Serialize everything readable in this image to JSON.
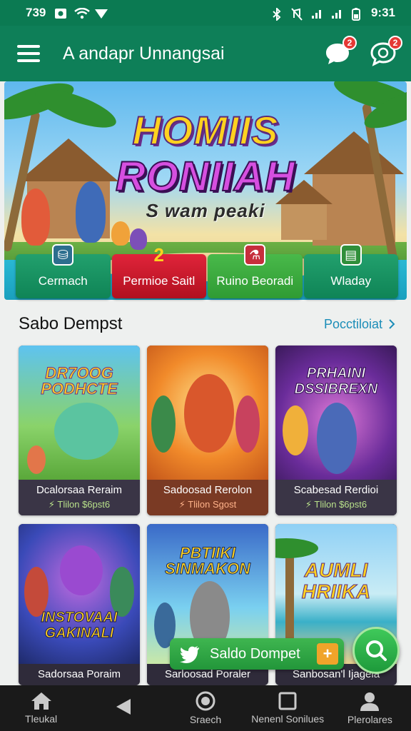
{
  "status_bar": {
    "time_left": "739",
    "time_right": "9:31"
  },
  "app_bar": {
    "title": "A andapr Unnangsai",
    "chat_badge": "2",
    "notify_badge": "2"
  },
  "hero": {
    "title_line1": "HOMIIS",
    "title_line2": "RONIIAH",
    "title_line3": "S wam peaki"
  },
  "tabs": [
    {
      "label": "Cermach",
      "icon": "barrel-icon"
    },
    {
      "label": "Permioe Saitl",
      "icon": "swirl-icon"
    },
    {
      "label": "Ruino Beoradi",
      "icon": "potion-icon"
    },
    {
      "label": "Wladay",
      "icon": "ledger-icon"
    }
  ],
  "section": {
    "title": "Sabo Dempst",
    "link": "Pocctiloiat"
  },
  "games": [
    {
      "art_title": "DR7OOG PODHCTE",
      "name": "Dcalorsaa Reraim",
      "meta": "Tlilon $6pst6"
    },
    {
      "art_title": "",
      "name": "Sadoosad Rerolon",
      "meta": "Tlilon Sgost"
    },
    {
      "art_title": "PRHAINI DSSIBREXN",
      "name": "Scabesad Rerdioi",
      "meta": "Tlilon $6pst6"
    },
    {
      "art_title": "INSTOVAAI GAKINALI",
      "name": "Sadorsaa Poraim",
      "meta": ""
    },
    {
      "art_title": "PBTIIKI SINMAKON",
      "name": "Sarloosad Poraler",
      "meta": ""
    },
    {
      "art_title": "AUMLI HRIIKA",
      "name": "Sanbosan'l Ijagela",
      "meta": ""
    }
  ],
  "wallet": {
    "label": "Saldo Dompet",
    "plus": "+"
  },
  "bottom_nav": [
    {
      "label": "Tleukal",
      "icon": "home-icon"
    },
    {
      "label": "",
      "icon": "back-icon"
    },
    {
      "label": "Sraech",
      "icon": "circle-home-icon"
    },
    {
      "label": "Nenenl Sonilues",
      "icon": "square-recents-icon"
    },
    {
      "label": "Plerolares",
      "icon": "profile-icon"
    }
  ],
  "colors": {
    "primary": "#0e7f58",
    "accent_red": "#d32f2f",
    "link": "#1b8db8"
  }
}
